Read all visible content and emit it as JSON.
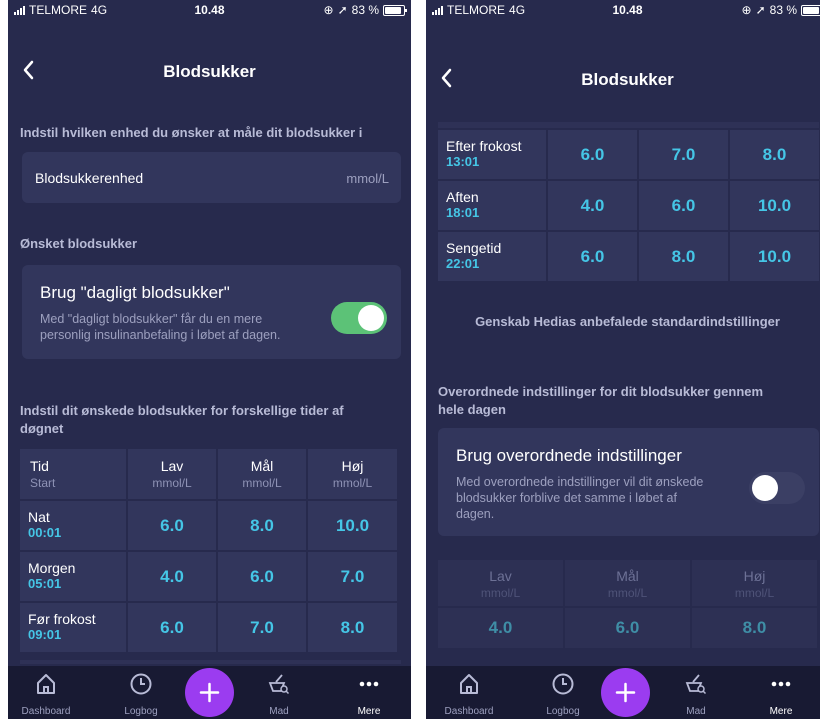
{
  "status": {
    "carrier": "TELMORE",
    "network": "4G",
    "time": "10.48",
    "battery": "83 %"
  },
  "left": {
    "title": "Blodsukker",
    "unit_section_label": "Indstil hvilken enhed du ønsker at måle dit blodsukker i",
    "unit_row": {
      "label": "Blodsukkerenhed",
      "value": "mmol/L"
    },
    "desired_section_label": "Ønsket blodsukker",
    "daily_toggle": {
      "title": "Brug \"dagligt blodsukker\"",
      "description_1": "Med \"dagligt blodsukker\" får du en mere",
      "description_2": "personlig insulinanbefaling i løbet af dagen.",
      "enabled": true
    },
    "times_section_label_1": "Indstil dit ønskede blodsukker for forskellige tider af",
    "times_section_label_2": "døgnet",
    "table_header": [
      {
        "title": "Tid",
        "sub": "Start"
      },
      {
        "title": "Lav",
        "sub": "mmol/L"
      },
      {
        "title": "Mål",
        "sub": "mmol/L"
      },
      {
        "title": "Høj",
        "sub": "mmol/L"
      }
    ],
    "rows": [
      {
        "name": "Nat",
        "time": "00:01",
        "low": "6.0",
        "target": "8.0",
        "high": "10.0"
      },
      {
        "name": "Morgen",
        "time": "05:01",
        "low": "4.0",
        "target": "6.0",
        "high": "7.0"
      },
      {
        "name": "Før frokost",
        "time": "09:01",
        "low": "6.0",
        "target": "7.0",
        "high": "8.0"
      }
    ]
  },
  "right": {
    "title": "Blodsukker",
    "rows": [
      {
        "name": "Efter frokost",
        "time": "13:01",
        "low": "6.0",
        "target": "7.0",
        "high": "8.0"
      },
      {
        "name": "Aften",
        "time": "18:01",
        "low": "4.0",
        "target": "6.0",
        "high": "10.0"
      },
      {
        "name": "Sengetid",
        "time": "22:01",
        "low": "6.0",
        "target": "8.0",
        "high": "10.0"
      }
    ],
    "reset_label": "Genskab Hedias anbefalede standardindstillinger",
    "overall_section_label_1": "Overordnede indstillinger for dit blodsukker gennem",
    "overall_section_label_2": "hele dagen",
    "overall_toggle": {
      "title": "Brug overordnede indstillinger",
      "description_1": "Med overordnede indstillinger vil dit ønskede",
      "description_2": "blodsukker forblive det samme i løbet af",
      "description_3": "dagen.",
      "enabled": false
    },
    "overall_header": [
      {
        "title": "Lav",
        "sub": "mmol/L"
      },
      {
        "title": "Mål",
        "sub": "mmol/L"
      },
      {
        "title": "Høj",
        "sub": "mmol/L"
      }
    ],
    "overall_values": {
      "low": "4.0",
      "target": "6.0",
      "high": "8.0"
    }
  },
  "tabs": [
    {
      "label": "Dashboard",
      "icon": "home-icon"
    },
    {
      "label": "Logbog",
      "icon": "clock-icon"
    },
    {
      "label": "",
      "icon": "plus-icon"
    },
    {
      "label": "Mad",
      "icon": "food-search-icon"
    },
    {
      "label": "Mere",
      "icon": "more-dots-icon"
    }
  ],
  "colors": {
    "background": "#272a4d",
    "card": "#32365c",
    "accent_value": "#45c6e6",
    "toggle_on": "#5cc277",
    "plus_button": "#9b3cf0"
  }
}
